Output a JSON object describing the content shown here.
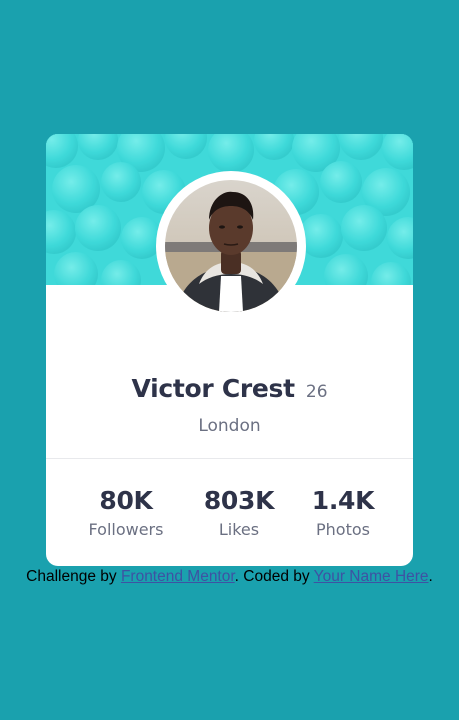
{
  "profile": {
    "name": "Victor Crest",
    "age": "26",
    "location": "London"
  },
  "stats": [
    {
      "value": "80K",
      "label": "Followers"
    },
    {
      "value": "803K",
      "label": "Likes"
    },
    {
      "value": "1.4K",
      "label": "Photos"
    }
  ],
  "attribution": {
    "prefix": "Challenge by",
    "link1": "Frontend Mentor",
    "middle": ". Coded by",
    "link2": "Your Name Here",
    "suffix": "."
  },
  "colors": {
    "page_background": "#1aa1ae",
    "banner": "#3fd9d9",
    "heading_text": "#2e3349",
    "muted_text": "#6b7082",
    "link": "#3e52a3"
  }
}
